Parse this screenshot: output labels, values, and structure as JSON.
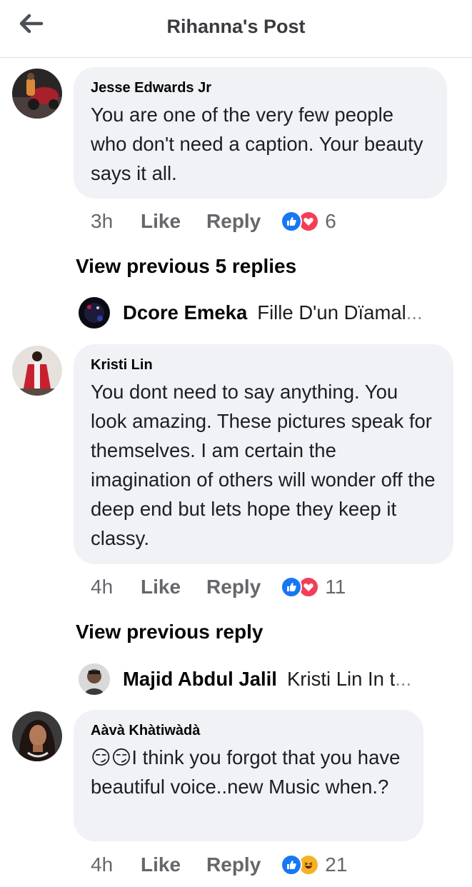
{
  "header": {
    "title": "Rihanna's Post",
    "back_icon": "arrow-left-icon"
  },
  "comments": [
    {
      "author": "Jesse Edwards Jr",
      "text": "You are one of the very few people who don't need a caption. Your beauty says it all.",
      "time": "3h",
      "like_label": "Like",
      "reply_label": "Reply",
      "reactions": [
        "like-reaction-icon",
        "love-reaction-icon"
      ],
      "reaction_count": "6",
      "view_previous": "View previous 5 replies",
      "reply_preview": {
        "name": "Dcore Emeka",
        "text": "Fille D'un Dïamal",
        "ellipsis": "..."
      }
    },
    {
      "author": "Kristi Lin",
      "text": "You dont need to say anything. You look amazing. These pictures speak for themselves. I am certain the imagination of others will wonder off the deep end but lets hope they keep it classy.",
      "time": "4h",
      "like_label": "Like",
      "reply_label": "Reply",
      "reactions": [
        "like-reaction-icon",
        "love-reaction-icon"
      ],
      "reaction_count": "11",
      "view_previous": "View previous reply",
      "reply_preview": {
        "name": "Majid Abdul Jalil",
        "text": "Kristi Lin In t",
        "ellipsis": "..."
      }
    },
    {
      "author": "Aàvà Khàtiwàdà",
      "emoji": "😏😏",
      "text": "I think you forgot that you have beautiful voice..new Music when.?",
      "time": "4h",
      "like_label": "Like",
      "reply_label": "Reply",
      "reactions": [
        "like-reaction-icon",
        "haha-reaction-icon"
      ],
      "reaction_count": "21"
    }
  ],
  "colors": {
    "like_blue": "#1877f2",
    "love_red": "#f33e58",
    "haha_yellow": "#f7b125",
    "bubble_bg": "#f0f2f5",
    "meta_gray": "#65676b"
  }
}
